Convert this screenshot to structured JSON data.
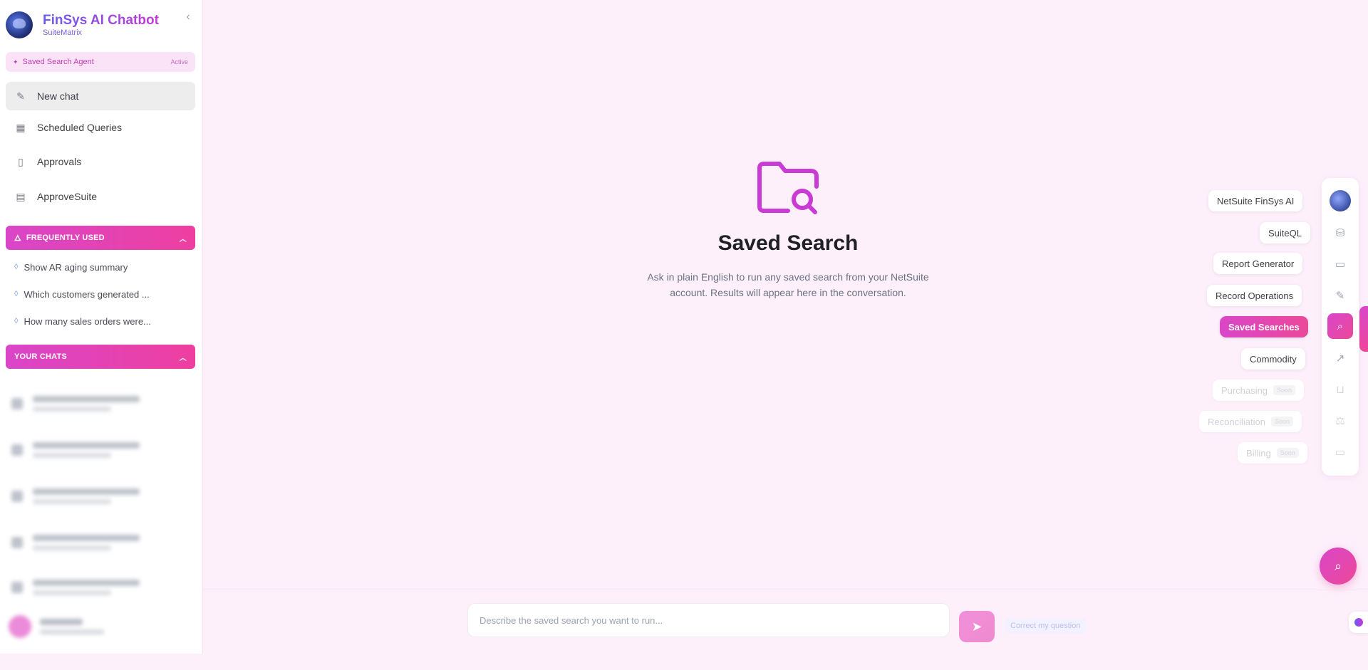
{
  "brand": {
    "title": "FinSys AI Chatbot",
    "subtitle": "SuiteMatrix",
    "logo_icon": "robot-avatar-icon"
  },
  "agent_pill": {
    "label": "Saved Search Agent",
    "status": "Active"
  },
  "nav": {
    "new_chat": "New chat",
    "scheduled": "Scheduled Queries",
    "approvals": "Approvals",
    "approve_suite": "ApproveSuite"
  },
  "frequently_used": {
    "title": "FREQUENTLY USED",
    "items": [
      "Show AR aging summary",
      "Which customers generated ...",
      "How many sales orders were..."
    ]
  },
  "your_chats": {
    "title": "YOUR CHATS"
  },
  "hero": {
    "title": "Saved Search",
    "description": "Ask in plain English to run any saved search from your NetSuite account. Results will appear here in the conversation."
  },
  "modes": {
    "netsuite": "NetSuite FinSys AI",
    "suiteql": "SuiteQL",
    "report": "Report Generator",
    "record": "Record Operations",
    "saved": "Saved Searches",
    "commodity": "Commodity",
    "purchasing": "Purchasing",
    "reconciliation": "Reconciliation",
    "billing": "Billing",
    "soon": "Soon"
  },
  "composer": {
    "placeholder": "Describe the saved search you want to run...",
    "correct": "Correct my question"
  },
  "colors": {
    "accent": "#d946c8",
    "accent2": "#ec4899",
    "background": "#fdf0fb"
  }
}
